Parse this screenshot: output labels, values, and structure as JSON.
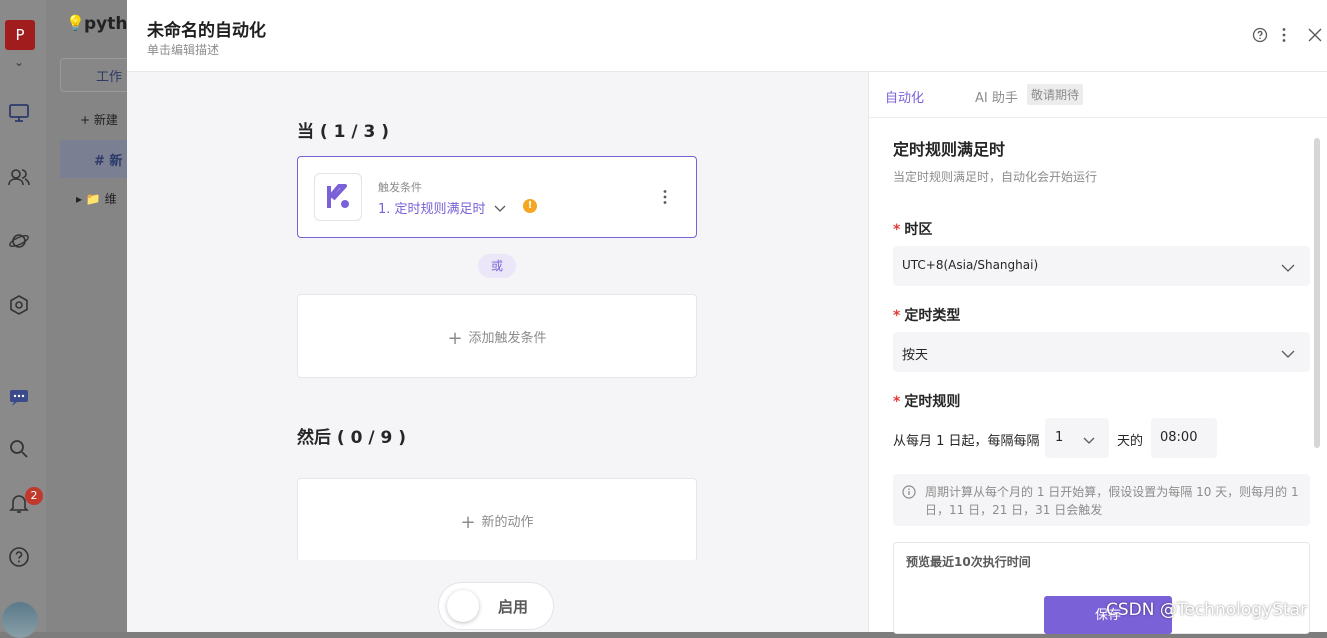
{
  "background": {
    "workspace_title": "pytho",
    "avatar_letter": "P",
    "tab_label": "工作",
    "new_label": "新建",
    "active_item_label": "新",
    "folder_label": "维",
    "notification_count": "2"
  },
  "modal": {
    "title": "未命名的自动化",
    "subtitle": "单击编辑描述"
  },
  "canvas": {
    "when_heading": "当 ( 1 / 3 )",
    "trigger_card": {
      "caption": "触发条件",
      "value": "1. 定时规则满足时"
    },
    "or_label": "或",
    "add_trigger_label": "添加触发条件",
    "then_heading": "然后 ( 0 / 9 )",
    "new_action_label": "新的动作",
    "enable_label": "启用"
  },
  "right_panel": {
    "tabs": [
      "自动化",
      "AI 助手"
    ],
    "ai_badge": "敬请期待",
    "title": "定时规则满足时",
    "description": "当定时规则满足时，自动化会开始运行",
    "timezone": {
      "label": "时区",
      "value": "UTC+8(Asia/Shanghai)"
    },
    "schedule_type": {
      "label": "定时类型",
      "value": "按天"
    },
    "schedule_rule": {
      "label": "定时规则",
      "prefix": "从每月 1 日起，每隔每隔",
      "interval": "1",
      "unit": "天的",
      "time": "08:00"
    },
    "info_text": "周期计算从每个月的 1 日开始算，假设设置为每隔 10 天，则每月的 1 日，11 日，21 日，31 日会触发",
    "preview_title": "预览最近10次执行时间",
    "save_label": "保存"
  },
  "watermark": "CSDN @TechnologyStar",
  "colors": {
    "accent": "#7b61d8",
    "warning": "#f5a623",
    "required": "#e53935",
    "badge_red": "#e03a2f"
  }
}
